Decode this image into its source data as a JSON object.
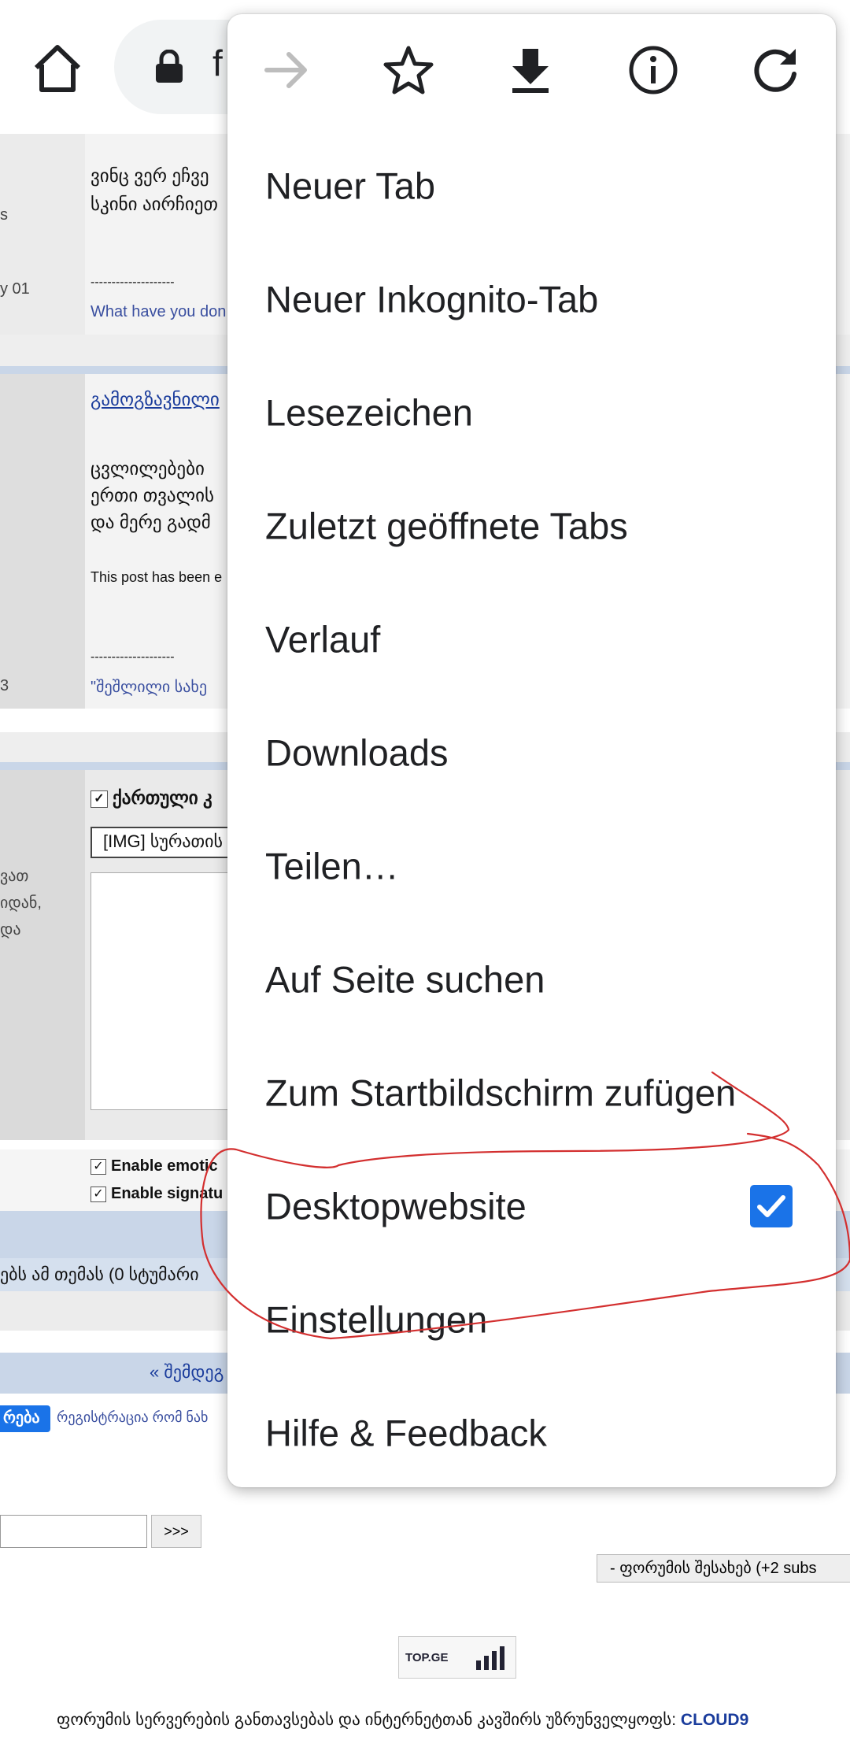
{
  "toolbar": {
    "url_fragment": "f"
  },
  "page": {
    "post1": {
      "text_line1": "ვინც ვერ ეჩვე",
      "text_line2": "სკინი აირჩიეთ",
      "sig_dash": "--------------------",
      "sig_link": "What have you don",
      "side_a": "s",
      "side_b": "y 01"
    },
    "post2": {
      "title_link": "გამოგზავნილი",
      "text_line1": "ცვლილებები",
      "text_line2": "ერთი თვალის",
      "text_line3": "და მერე გადმ",
      "edited_note": "This post has been e",
      "sig_dash": "--------------------",
      "sig_link": "\"შეშლილი სახე",
      "side_a": "3"
    },
    "reply": {
      "lang_checkbox_label": "ქართული კ",
      "img_button": "[IMG] სურათის",
      "side_line1": "ვათ",
      "side_line2": "იდან,",
      "side_line3": "და",
      "enable_emotic": "Enable emotic",
      "enable_signature": "Enable signatu"
    },
    "readers_line": "ებს ამ თემას (0 სტუმარი",
    "prev_next": "« შემდეგ",
    "register_btn": "რება",
    "register_text": "რეგისტრაცია რომ ნახ",
    "go_button": ">>>",
    "forum_select": "- ფორუმის შესახებ (+2 subs",
    "top_ge_badge": "TOP.GE",
    "footer_text": "ფორუმის სერვერების განთავსებას და ინტერნეტთან კავშირს უზრუნველყოფს:",
    "footer_link": "CLOUD9"
  },
  "menu": {
    "icons": [
      "forward-arrow-icon",
      "star-icon",
      "download-icon",
      "info-icon",
      "reload-icon"
    ],
    "items": [
      {
        "label": "Neuer Tab"
      },
      {
        "label": "Neuer Inkognito-Tab"
      },
      {
        "label": "Lesezeichen"
      },
      {
        "label": "Zuletzt geöffnete Tabs"
      },
      {
        "label": "Verlauf"
      },
      {
        "label": "Downloads"
      },
      {
        "label": "Teilen…"
      },
      {
        "label": "Auf Seite suchen"
      },
      {
        "label": "Zum Startbildschirm zufügen"
      },
      {
        "label": "Desktopwebsite",
        "checked": true
      },
      {
        "label": "Einstellungen"
      },
      {
        "label": "Hilfe & Feedback"
      }
    ]
  },
  "colors": {
    "accent": "#1a73e8",
    "annotation": "#d32f2f"
  }
}
